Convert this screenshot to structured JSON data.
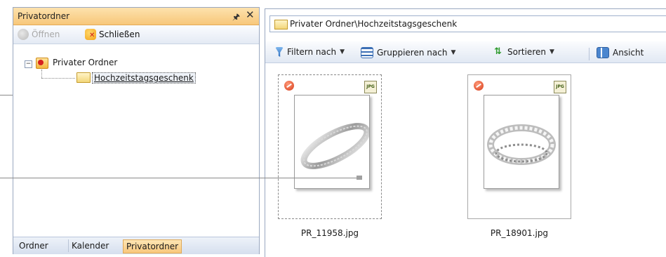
{
  "left_panel": {
    "title": "Privatordner",
    "pin_icon": "pin-icon",
    "close_icon": "close-icon",
    "toolbar": {
      "open_label": "Öffnen",
      "close_label": "Schließen"
    },
    "tree": {
      "root": "Privater Ordner",
      "child": "Hochzeitstagsgeschenk"
    },
    "tabs": [
      "Ordner",
      "Kalender",
      "Privatordner"
    ],
    "active_tab": "Privatordner"
  },
  "right_panel": {
    "path": "Privater Ordner\\Hochzeitstagsgeschenk",
    "toolbar": {
      "filter_label": "Filtern nach",
      "group_label": "Gruppieren nach",
      "sort_label": "Sortieren",
      "view_label": "Ansicht"
    },
    "thumbnails": [
      {
        "caption": "PR_11958.jpg",
        "badge": "JPG",
        "selected": true
      },
      {
        "caption": "PR_18901.jpg",
        "badge": "JPG",
        "selected": false
      }
    ]
  },
  "colors": {
    "title_bar": "#f7c77a",
    "active_tab": "#f8c77c",
    "border": "#9aa8c0"
  }
}
